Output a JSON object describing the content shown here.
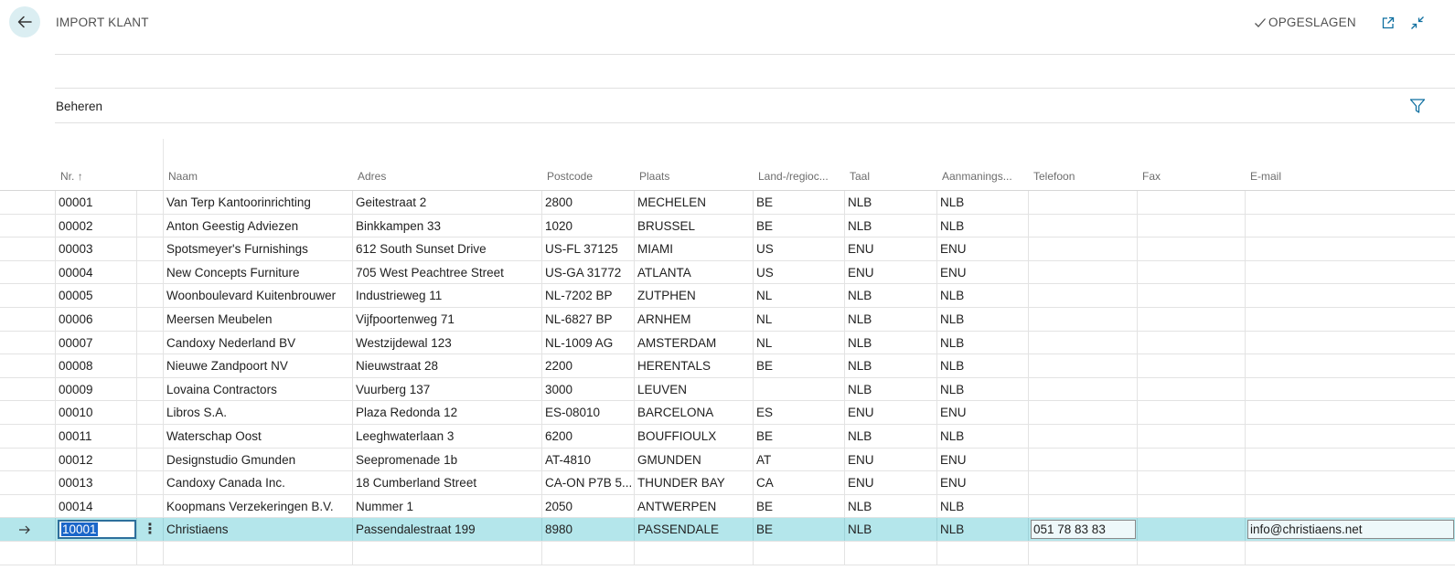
{
  "header": {
    "title": "IMPORT KLANT",
    "saved_label": "OPGESLAGEN"
  },
  "actions": {
    "label": "Beheren"
  },
  "columns": {
    "nr": "Nr.",
    "sort_indicator": "↑",
    "naam": "Naam",
    "adres": "Adres",
    "postcode": "Postcode",
    "plaats": "Plaats",
    "land": "Land-/regioc...",
    "taal": "Taal",
    "aanmaning": "Aanmanings...",
    "telefoon": "Telefoon",
    "fax": "Fax",
    "email": "E-mail"
  },
  "rows": [
    {
      "nr": "00001",
      "naam": "Van Terp Kantoorinrichting",
      "adres": "Geitestraat 2",
      "postcode": "2800",
      "plaats": "MECHELEN",
      "land": "BE",
      "taal": "NLB",
      "aanmaning": "NLB",
      "telefoon": "",
      "fax": "",
      "email": ""
    },
    {
      "nr": "00002",
      "naam": "Anton Geestig Adviezen",
      "adres": "Binkkampen 33",
      "postcode": "1020",
      "plaats": "BRUSSEL",
      "land": "BE",
      "taal": "NLB",
      "aanmaning": "NLB",
      "telefoon": "",
      "fax": "",
      "email": ""
    },
    {
      "nr": "00003",
      "naam": "Spotsmeyer's Furnishings",
      "adres": "612 South Sunset Drive",
      "postcode": "US-FL 37125",
      "plaats": "MIAMI",
      "land": "US",
      "taal": "ENU",
      "aanmaning": "ENU",
      "telefoon": "",
      "fax": "",
      "email": ""
    },
    {
      "nr": "00004",
      "naam": "New Concepts Furniture",
      "adres": "705 West Peachtree Street",
      "postcode": "US-GA 31772",
      "plaats": "ATLANTA",
      "land": "US",
      "taal": "ENU",
      "aanmaning": "ENU",
      "telefoon": "",
      "fax": "",
      "email": ""
    },
    {
      "nr": "00005",
      "naam": "Woonboulevard Kuitenbrouwer",
      "adres": "Industrieweg 11",
      "postcode": "NL-7202 BP",
      "plaats": "ZUTPHEN",
      "land": "NL",
      "taal": "NLB",
      "aanmaning": "NLB",
      "telefoon": "",
      "fax": "",
      "email": ""
    },
    {
      "nr": "00006",
      "naam": "Meersen Meubelen",
      "adres": "Vijfpoortenweg 71",
      "postcode": "NL-6827 BP",
      "plaats": "ARNHEM",
      "land": "NL",
      "taal": "NLB",
      "aanmaning": "NLB",
      "telefoon": "",
      "fax": "",
      "email": ""
    },
    {
      "nr": "00007",
      "naam": "Candoxy Nederland BV",
      "adres": "Westzijdewal 123",
      "postcode": "NL-1009 AG",
      "plaats": "AMSTERDAM",
      "land": "NL",
      "taal": "NLB",
      "aanmaning": "NLB",
      "telefoon": "",
      "fax": "",
      "email": ""
    },
    {
      "nr": "00008",
      "naam": "Nieuwe Zandpoort NV",
      "adres": "Nieuwstraat 28",
      "postcode": "2200",
      "plaats": "HERENTALS",
      "land": "BE",
      "taal": "NLB",
      "aanmaning": "NLB",
      "telefoon": "",
      "fax": "",
      "email": ""
    },
    {
      "nr": "00009",
      "naam": "Lovaina Contractors",
      "adres": "Vuurberg 137",
      "postcode": "3000",
      "plaats": "LEUVEN",
      "land": "",
      "taal": "NLB",
      "aanmaning": "NLB",
      "telefoon": "",
      "fax": "",
      "email": ""
    },
    {
      "nr": "00010",
      "naam": "Libros S.A.",
      "adres": "Plaza Redonda 12",
      "postcode": "ES-08010",
      "plaats": "BARCELONA",
      "land": "ES",
      "taal": "ENU",
      "aanmaning": "ENU",
      "telefoon": "",
      "fax": "",
      "email": ""
    },
    {
      "nr": "00011",
      "naam": "Waterschap Oost",
      "adres": "Leeghwaterlaan 3",
      "postcode": "6200",
      "plaats": "BOUFFIOULX",
      "land": "BE",
      "taal": "NLB",
      "aanmaning": "NLB",
      "telefoon": "",
      "fax": "",
      "email": ""
    },
    {
      "nr": "00012",
      "naam": "Designstudio Gmunden",
      "adres": "Seepromenade 1b",
      "postcode": "AT-4810",
      "plaats": "GMUNDEN",
      "land": "AT",
      "taal": "ENU",
      "aanmaning": "ENU",
      "telefoon": "",
      "fax": "",
      "email": ""
    },
    {
      "nr": "00013",
      "naam": "Candoxy Canada Inc.",
      "adres": "18 Cumberland Street",
      "postcode": "CA-ON P7B 5...",
      "plaats": "THUNDER BAY",
      "land": "CA",
      "taal": "ENU",
      "aanmaning": "ENU",
      "telefoon": "",
      "fax": "",
      "email": ""
    },
    {
      "nr": "00014",
      "naam": "Koopmans Verzekeringen B.V.",
      "adres": "Nummer 1",
      "postcode": "2050",
      "plaats": "ANTWERPEN",
      "land": "BE",
      "taal": "NLB",
      "aanmaning": "NLB",
      "telefoon": "",
      "fax": "",
      "email": ""
    }
  ],
  "selected_row": {
    "nr": "10001",
    "naam": "Christiaens",
    "adres": "Passendalestraat 199",
    "postcode": "8980",
    "plaats": "PASSENDALE",
    "land": "BE",
    "taal": "NLB",
    "aanmaning": "NLB",
    "telefoon": "051 78 83 83",
    "fax": "",
    "email": "info@christiaens.net"
  },
  "row_menu_glyph": "⋮",
  "colors": {
    "accent": "#0f6fa0",
    "selected_row_bg": "#b4e6eb",
    "back_button_bg": "#dbeef2"
  },
  "icons": {
    "back": "arrow-left-icon",
    "saved": "checkmark-icon",
    "open_new": "open-in-new-window-icon",
    "collapse": "collapse-icon",
    "filter": "filter-icon",
    "row_arrow": "arrow-right-icon"
  }
}
